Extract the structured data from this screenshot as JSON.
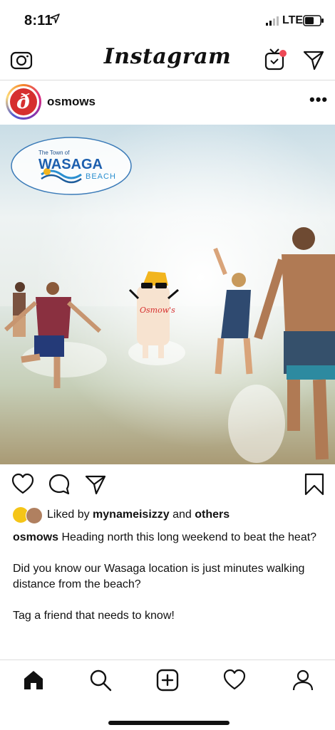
{
  "status_bar": {
    "time": "8:11",
    "network": "LTE"
  },
  "header": {
    "logo": "Instagram",
    "icons": [
      "camera-icon",
      "igtv-icon",
      "direct-send-icon"
    ]
  },
  "post": {
    "username": "osmows",
    "more_label": "•••",
    "image": {
      "overlay_town": "The Town of",
      "overlay_name": "WASAGA",
      "overlay_sub": "BEACH",
      "mascot_text": "Osmow's"
    },
    "liked_by_prefix": "Liked by",
    "liked_by_user": "mynameisizzy",
    "liked_by_and": "and",
    "liked_by_others": "others",
    "caption_user": "osmows",
    "caption_text": "Heading north this long weekend to beat the heat?",
    "caption_p2": "Did you know our Wasaga location is just minutes walking distance from the beach?",
    "caption_p3": "Tag a friend that needs to know!"
  },
  "tab_bar": {
    "tabs": [
      "home-icon",
      "search-icon",
      "new-post-icon",
      "activity-icon",
      "profile-icon"
    ]
  },
  "colors": {
    "text": "#111111",
    "divider": "#dddddd",
    "notification_dot": "#ed4956",
    "brand_red": "#d62f2f"
  }
}
